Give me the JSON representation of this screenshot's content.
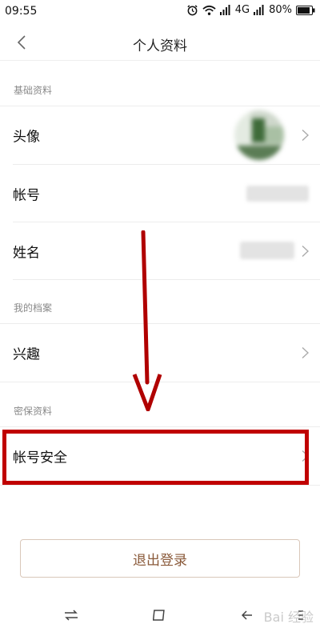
{
  "status_bar": {
    "time": "09:55",
    "network": "4G",
    "battery": "80%"
  },
  "nav": {
    "title": "个人资料",
    "back_icon": "chevron-left-icon"
  },
  "sections": {
    "basic": "基础资料",
    "archive": "我的档案",
    "security": "密保资料"
  },
  "rows": {
    "avatar": "头像",
    "account": "帐号",
    "name": "姓名",
    "interests": "兴趣",
    "account_security": "帐号安全"
  },
  "logout": {
    "label": "退出登录"
  },
  "watermark": "Bai 经验",
  "colors": {
    "highlight": "#c00000",
    "accent_text": "#8a5a3a"
  }
}
